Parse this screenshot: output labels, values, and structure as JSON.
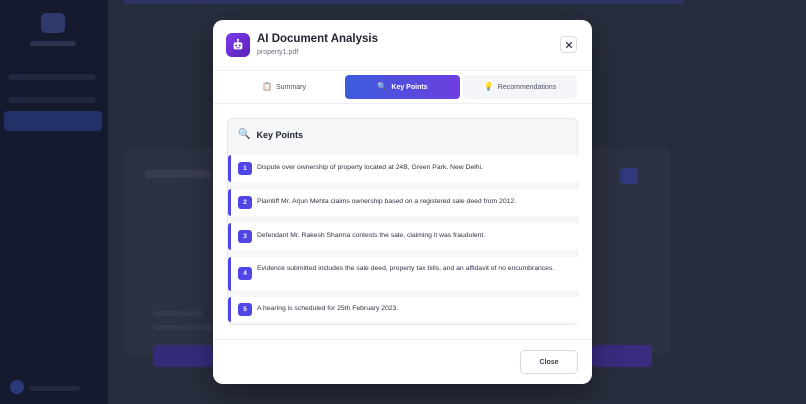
{
  "modal": {
    "title": "AI Document Analysis",
    "filename": "property1.pdf",
    "close_icon": "close-icon",
    "accent_color": "#4f46e5"
  },
  "tabs": [
    {
      "label": "Summary",
      "icon": "clipboard-icon",
      "active": false
    },
    {
      "label": "Key Points",
      "icon": "magnifier-icon",
      "active": true
    },
    {
      "label": "Recommendations",
      "icon": "lightbulb-icon",
      "active": false
    }
  ],
  "key_points": {
    "title": "Key Points",
    "items": [
      {
        "number": "1",
        "text": "Dispute over ownership of property located at 24B, Green Park, New Delhi."
      },
      {
        "number": "2",
        "text": "Plaintiff Mr. Arjun Mehta claims ownership based on a registered sale deed from 2012."
      },
      {
        "number": "3",
        "text": "Defendant Mr. Rakesh Sharma contests the sale, claiming it was fraudulent."
      },
      {
        "number": "4",
        "text": "Evidence submitted includes the sale deed, property tax bills, and an affidavit of no encumbrances."
      },
      {
        "number": "5",
        "text": "A hearing is scheduled for 25th February 2023."
      }
    ]
  },
  "footer": {
    "close_label": "Close"
  }
}
